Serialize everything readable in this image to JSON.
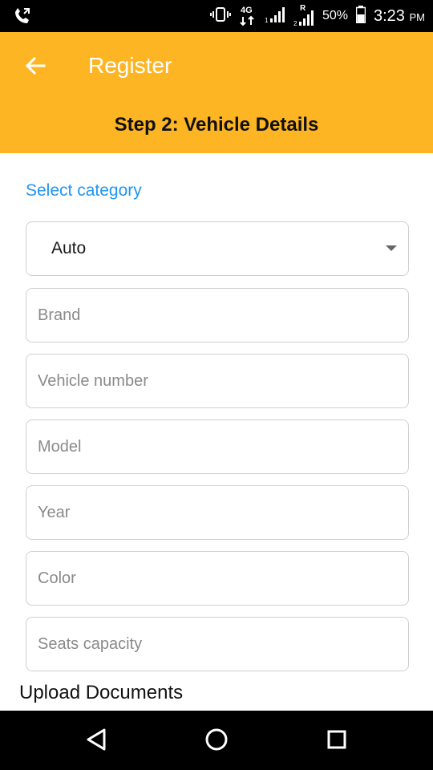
{
  "status_bar": {
    "network_label": "4G",
    "sim2_label": "R",
    "battery": "50%",
    "time": "3:23",
    "ampm": "PM"
  },
  "app_bar": {
    "title": "Register",
    "step_title": "Step 2: Vehicle Details",
    "background_color": "#FEB523"
  },
  "form": {
    "category_label": "Select category",
    "category_value": "Auto",
    "fields": [
      {
        "placeholder": "Brand"
      },
      {
        "placeholder": "Vehicle number"
      },
      {
        "placeholder": "Model"
      },
      {
        "placeholder": "Year"
      },
      {
        "placeholder": "Color"
      },
      {
        "placeholder": "Seats capacity"
      }
    ]
  },
  "upload_label": "Upload Documents",
  "icons": {
    "back": "arrow-left-icon",
    "dropdown": "caret-down-icon",
    "nav_back": "triangle-back-icon",
    "nav_home": "circle-home-icon",
    "nav_recents": "square-recents-icon"
  }
}
